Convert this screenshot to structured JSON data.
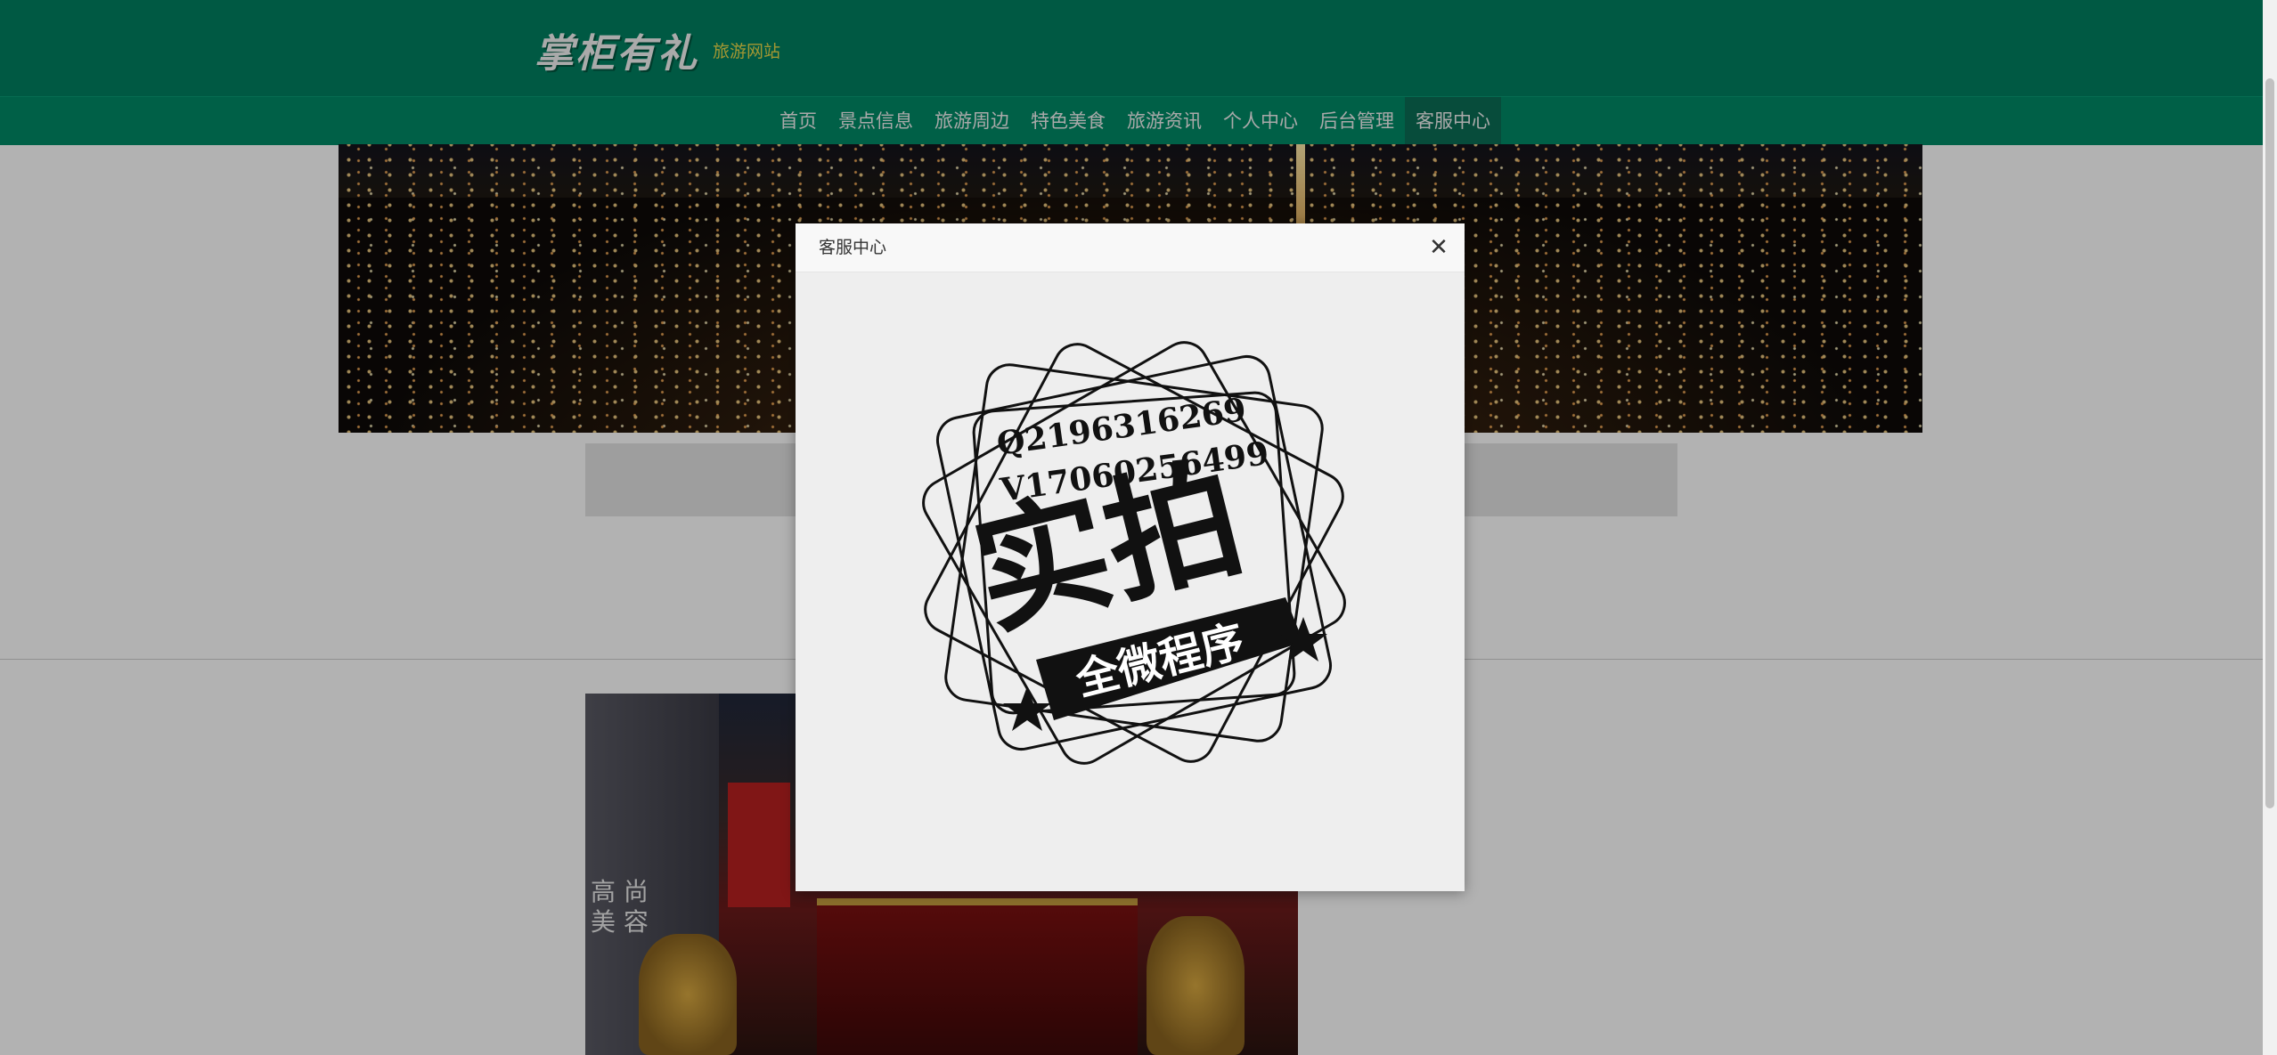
{
  "header": {
    "logo_text": "掌柜有礼",
    "site_name": "旅游网站"
  },
  "nav": {
    "items": [
      {
        "label": "首页"
      },
      {
        "label": "景点信息"
      },
      {
        "label": "旅游周边"
      },
      {
        "label": "特色美食"
      },
      {
        "label": "旅游资讯"
      },
      {
        "label": "个人中心"
      },
      {
        "label": "后台管理"
      },
      {
        "label": "客服中心"
      }
    ],
    "active": "客服中心"
  },
  "background_photo": {
    "sign_text": "高 尚 美 容"
  },
  "modal": {
    "title": "客服中心",
    "close_icon": "close-icon",
    "stamp": {
      "line1": "Q2196316269",
      "line2": "V17060256499",
      "big": "实拍",
      "ribbon": "全微程序"
    }
  },
  "colors": {
    "header_bg": "#008060",
    "nav_bg": "#008a66",
    "nav_active_bg": "#0b6e55",
    "site_name": "#e8d84a",
    "modal_bg": "#eeeeee"
  }
}
